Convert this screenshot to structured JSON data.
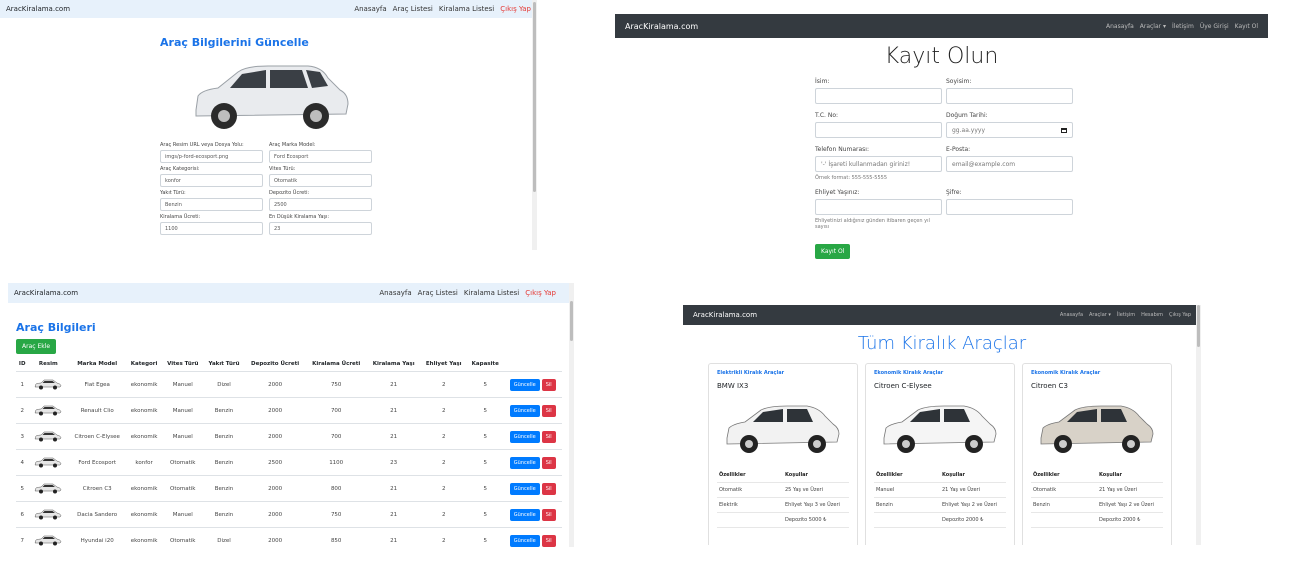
{
  "brand": "AracKiralama.com",
  "nav_admin": {
    "links": [
      "Anasayfa",
      "Araç Listesi",
      "Kiralama Listesi"
    ],
    "logout": "Çıkış Yap"
  },
  "nav_public": {
    "links": [
      "Anasayfa",
      "Araçlar ▾",
      "İletişim",
      "Üye Girişi",
      "Kayıt Ol"
    ]
  },
  "nav_member": {
    "links": [
      "Anasayfa",
      "Araçlar ▾",
      "İletişim",
      "Hesabım",
      "Çıkış Yap"
    ]
  },
  "update_form": {
    "title": "Araç Bilgilerini Güncelle",
    "fields": [
      {
        "label": "Araç Resim URL veya Dosya Yolu:",
        "value": "imgs/p-ford-ecosport.png"
      },
      {
        "label": "Araç Marka Model:",
        "value": "Ford Ecosport"
      },
      {
        "label": "Araç Kategorisi:",
        "value": "konfor"
      },
      {
        "label": "Vites Türü:",
        "value": "Otomatik"
      },
      {
        "label": "Yakıt Türü:",
        "value": "Benzin"
      },
      {
        "label": "Depozito Ücreti:",
        "value": "2500"
      },
      {
        "label": "Kiralama Ücreti:",
        "value": "1100"
      },
      {
        "label": "En Düşük Kiralama Yaşı:",
        "value": "23"
      }
    ]
  },
  "register": {
    "title": "Kayıt Olun",
    "fields": [
      {
        "label": "İsim:",
        "value": "",
        "help": ""
      },
      {
        "label": "Soyisim:",
        "value": "",
        "help": ""
      },
      {
        "label": "T.C. No:",
        "value": "",
        "help": ""
      },
      {
        "label": "Doğum Tarihi:",
        "value": "gg.aa.yyyy",
        "help": ""
      },
      {
        "label": "Telefon Numarası:",
        "value": "'-' İşareti kullanmadan giriniz!",
        "help": "Örnek format: 555-555-5555"
      },
      {
        "label": "E-Posta:",
        "value": "email@example.com",
        "help": ""
      },
      {
        "label": "Ehliyet Yaşınız:",
        "value": "",
        "help": "Ehliyetinizi aldığınız günden itibaren geçen yıl sayısı"
      },
      {
        "label": "Şifre:",
        "value": "",
        "help": ""
      }
    ],
    "submit": "Kayıt Ol"
  },
  "vehicles": {
    "title": "Araç Bilgileri",
    "add_button": "Araç Ekle",
    "columns": [
      "ID",
      "Resim",
      "Marka Model",
      "Kategori",
      "Vites Türü",
      "Yakıt Türü",
      "Depozito Ücreti",
      "Kiralama Ücreti",
      "Kiralama Yaşı",
      "Ehliyet Yaşı",
      "Kapasite",
      ""
    ],
    "rows": [
      [
        "1",
        "Fiat Egea",
        "ekonomik",
        "Manuel",
        "Dizel",
        "2000",
        "750",
        "21",
        "2",
        "5"
      ],
      [
        "2",
        "Renault Clio",
        "ekonomik",
        "Manuel",
        "Benzin",
        "2000",
        "700",
        "21",
        "2",
        "5"
      ],
      [
        "3",
        "Citroen C-Elysee",
        "ekonomik",
        "Manuel",
        "Benzin",
        "2000",
        "700",
        "21",
        "2",
        "5"
      ],
      [
        "4",
        "Ford Ecosport",
        "konfor",
        "Otomatik",
        "Benzin",
        "2500",
        "1100",
        "23",
        "2",
        "5"
      ],
      [
        "5",
        "Citroen C3",
        "ekonomik",
        "Otomatik",
        "Benzin",
        "2000",
        "800",
        "21",
        "2",
        "5"
      ],
      [
        "6",
        "Dacia Sandero",
        "ekonomik",
        "Manuel",
        "Benzin",
        "2000",
        "750",
        "21",
        "2",
        "5"
      ],
      [
        "7",
        "Hyundai i20",
        "ekonomik",
        "Otomatik",
        "Dizel",
        "2000",
        "850",
        "21",
        "2",
        "5"
      ]
    ],
    "update_label": "Güncelle",
    "delete_label": "Sil"
  },
  "catalog": {
    "title": "Tüm Kiralık Araçlar",
    "col_features": "Özellikler",
    "col_conditions": "Koşullar",
    "cars": [
      {
        "category": "Elektrikli Kiralık Araçlar",
        "name": "BMW IX3",
        "features": [
          "Otomatik",
          "Elektrik",
          ""
        ],
        "conditions": [
          "25 Yaş ve Üzeri",
          "Ehliyet Yaşı 3 ve Üzeri",
          "Depozito 5000 ₺"
        ],
        "color": "#f2f2f2"
      },
      {
        "category": "Ekonomik Kiralık Araçlar",
        "name": "Citroen C-Elysee",
        "features": [
          "Manuel",
          "Benzin",
          ""
        ],
        "conditions": [
          "21 Yaş ve Üzeri",
          "Ehliyet Yaşı 2 ve Üzeri",
          "Depozito 2000 ₺"
        ],
        "color": "#f5f5f5"
      },
      {
        "category": "Ekonomik Kiralık Araçlar",
        "name": "Citroen C3",
        "features": [
          "Otomatik",
          "Benzin",
          ""
        ],
        "conditions": [
          "21 Yaş ve Üzeri",
          "Ehliyet Yaşı 2 ve Üzeri",
          "Depozito 2000 ₺"
        ],
        "color": "#d8d2c8"
      }
    ]
  }
}
